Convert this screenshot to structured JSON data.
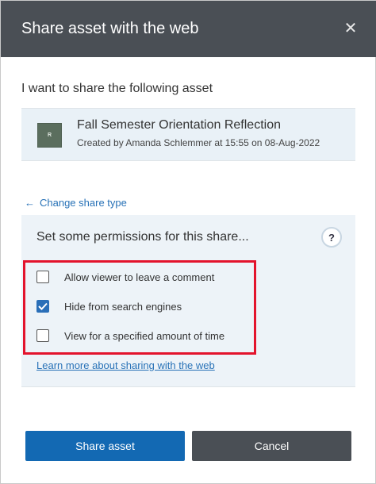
{
  "dialog": {
    "title": "Share asset with the web",
    "close_icon": "close-icon"
  },
  "intro": "I want to share the following asset",
  "asset": {
    "thumbnail_letter": "R",
    "name": "Fall Semester Orientation Reflection",
    "meta": "Created by Amanda Schlemmer at 15:55 on 08-Aug-2022"
  },
  "change_share_type": "Change share type",
  "permissions": {
    "heading": "Set some permissions for this share...",
    "help_label": "?",
    "options": [
      {
        "label": "Allow viewer to leave a comment",
        "checked": false
      },
      {
        "label": "Hide from search engines",
        "checked": true
      },
      {
        "label": "View for a specified amount of time",
        "checked": false
      }
    ],
    "learn_more": "Learn more about sharing with the web"
  },
  "buttons": {
    "share": "Share asset",
    "cancel": "Cancel"
  },
  "colors": {
    "header_bg": "#4a4f55",
    "primary": "#1369b3",
    "link": "#2872b7",
    "highlight": "#e3132c"
  }
}
